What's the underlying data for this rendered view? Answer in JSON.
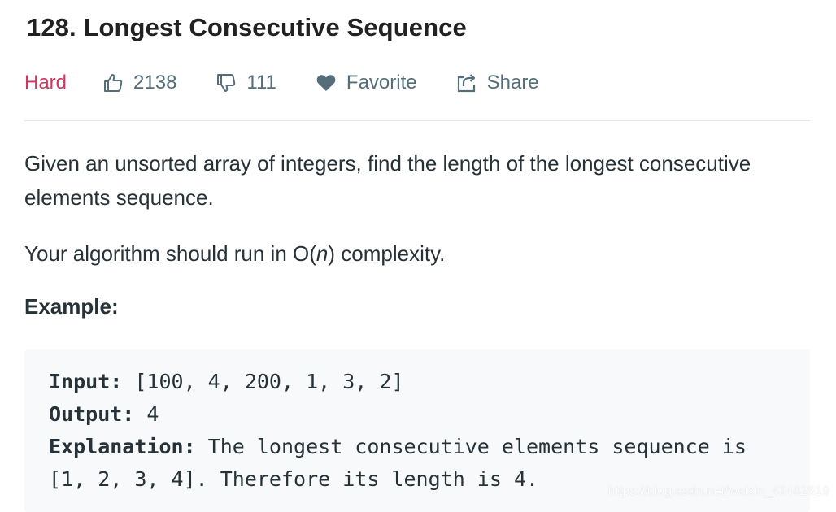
{
  "problem": {
    "title": "128. Longest Consecutive Sequence",
    "difficulty": "Hard",
    "likes": "2138",
    "dislikes": "111",
    "favorite_label": "Favorite",
    "share_label": "Share"
  },
  "description": {
    "paragraph1": "Given an unsorted array of integers, find the length of the longest consecutive elements sequence.",
    "paragraph2_prefix": "Your algorithm should run in O(",
    "paragraph2_var": "n",
    "paragraph2_suffix": ") complexity.",
    "example_label": "Example:"
  },
  "example": {
    "input_label": "Input:",
    "input_value": " [100, 4, 200, 1, 3, 2]",
    "output_label": "Output:",
    "output_value": " 4",
    "explanation_label": "Explanation:",
    "explanation_value": " The longest consecutive elements sequence is",
    "explanation_line2": "[1, 2, 3, 4]. Therefore its length is 4."
  },
  "watermark": "https://blog.csdn.net/weixin_43462819",
  "colors": {
    "difficulty_hard": "#d0345f",
    "meta_text": "#546e7a",
    "code_bg": "#f7f9fa"
  },
  "icons": {
    "like": "thumbs-up-icon",
    "dislike": "thumbs-down-icon",
    "favorite": "heart-icon",
    "share": "share-icon"
  }
}
